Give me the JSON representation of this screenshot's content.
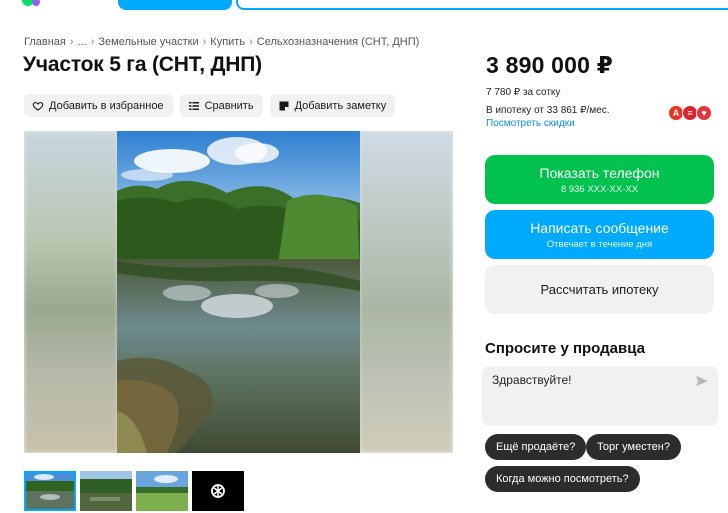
{
  "header": {
    "logo_text": "авито"
  },
  "breadcrumb": [
    "Главная",
    "...",
    "Земельные участки",
    "Купить",
    "Сельхозназначения (СНТ, ДНП)"
  ],
  "title": "Участок 5 га (СНТ, ДНП)",
  "actions": {
    "favorite": "Добавить в избранное",
    "compare": "Сравнить",
    "note": "Добавить заметку"
  },
  "price": {
    "value": "3 890 000 ₽",
    "per_sotka": "7 780 ₽ за сотку",
    "mortgage": "В ипотеку от 33 861 ₽/мес.",
    "discounts_link": "Посмотреть скидки"
  },
  "banks": [
    {
      "icon": "alfa-bank-icon",
      "letter": "А",
      "color": "#ef3124"
    },
    {
      "icon": "bank-icon",
      "letter": "≡",
      "color": "#d7262f"
    },
    {
      "icon": "bank-icon",
      "letter": "♥",
      "color": "#e3353b"
    }
  ],
  "buttons": {
    "phone_label": "Показать телефон",
    "phone_number": "8 936 XXX-XX-XX",
    "message_label": "Написать сообщение",
    "message_sub": "Отвечает в течение дня",
    "mortgage_calc": "Рассчитать ипотеку"
  },
  "ask": {
    "title": "Спросите у продавца",
    "message": "Здравствуйте!",
    "chips": [
      "Ещё продаёте?",
      "Торг уместен?",
      "Когда можно посмотреть?"
    ]
  },
  "colors": {
    "accent_blue": "#00aaff",
    "green": "#02c24f",
    "chip_dark": "#2c2c2c"
  }
}
